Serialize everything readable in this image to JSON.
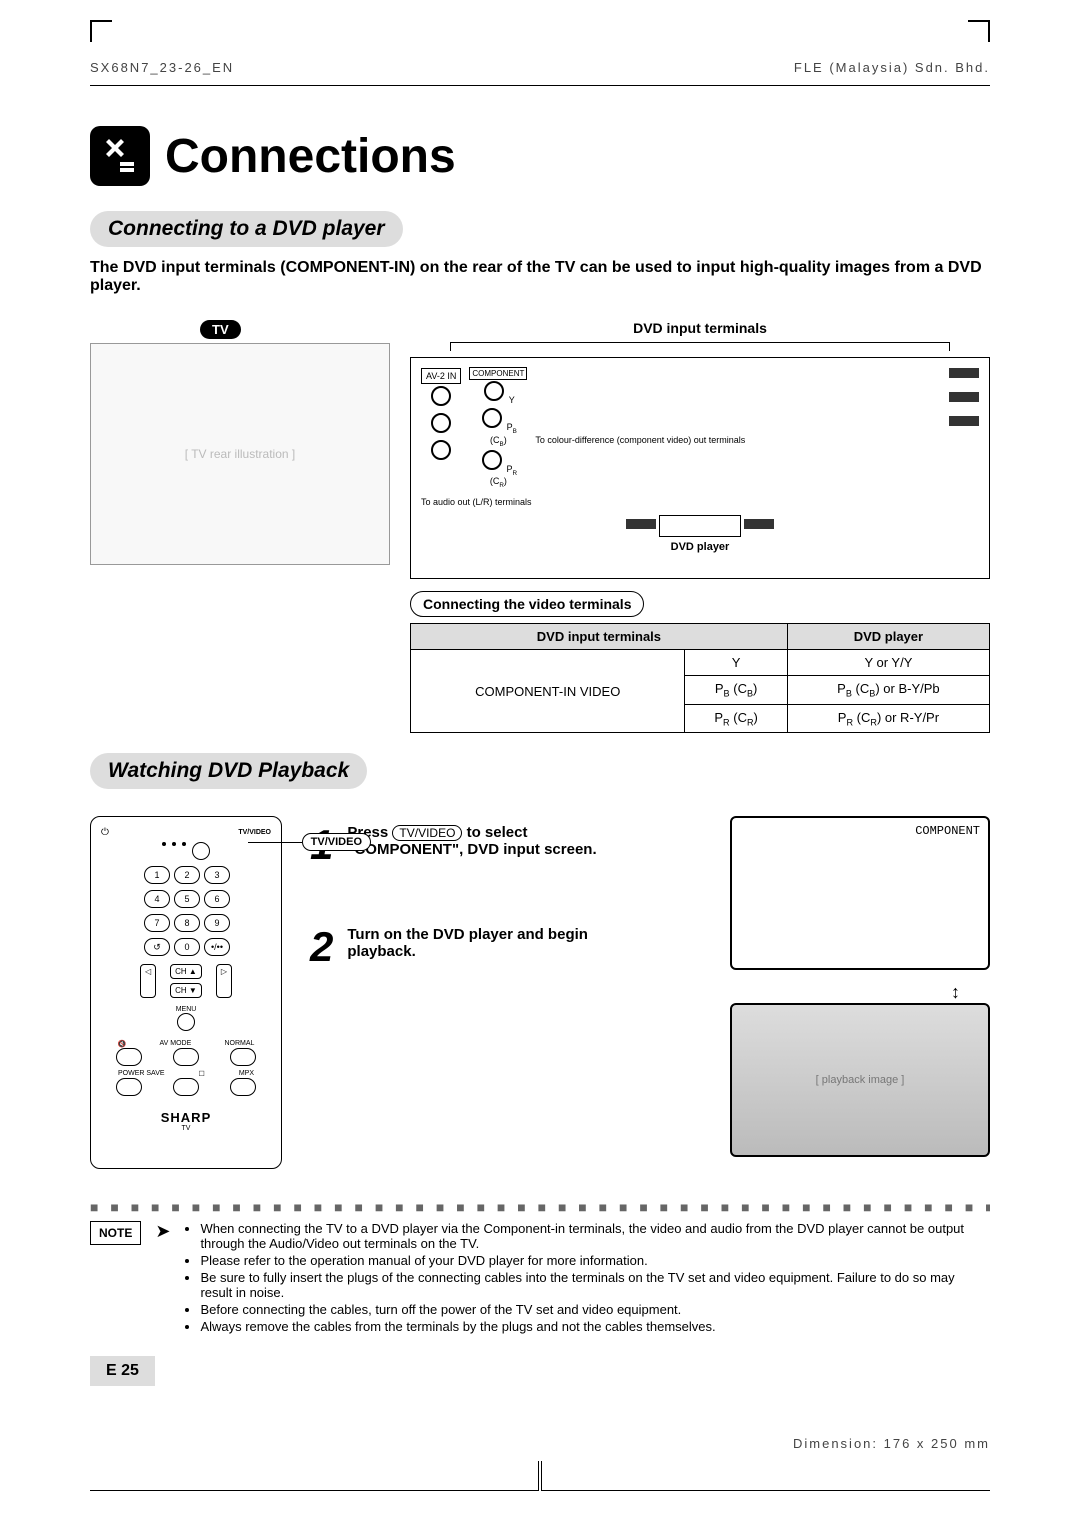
{
  "header": {
    "left": "SX68N7_23-26_EN",
    "right": "FLE (Malaysia) Sdn. Bhd."
  },
  "title": "Connections",
  "section1": {
    "heading": "Connecting to a DVD player",
    "intro": "The DVD input terminals (COMPONENT-IN) on the rear of the TV can be used to input high-quality images from a DVD player."
  },
  "diagram": {
    "tv_label": "TV",
    "terminals_title": "DVD input terminals",
    "av2": "AV-2 IN",
    "component": "COMPONENT",
    "y": "Y",
    "pb": "PB (CB)",
    "pr": "PR (CR)",
    "audio_note": "To audio out (L/R) terminals",
    "video_note": "To colour-difference (component video) out terminals",
    "dvd_label": "DVD player"
  },
  "table": {
    "caption": "Connecting the video terminals",
    "head_left": "DVD input terminals",
    "head_right": "DVD player",
    "rowspan_label": "COMPONENT-IN VIDEO",
    "rows": [
      {
        "in": "Y",
        "out": "Y or Y/Y"
      },
      {
        "in": "PB (CB)",
        "out": "PB (CB) or B-Y/Pb"
      },
      {
        "in": "PR (CR)",
        "out": "PR (CR) or R-Y/Pr"
      }
    ]
  },
  "section2": {
    "heading": "Watching DVD Playback"
  },
  "remote": {
    "tvvideo": "TV/VIDEO",
    "keys": [
      "1",
      "2",
      "3",
      "4",
      "5",
      "6",
      "7",
      "8",
      "9",
      "",
      "0",
      ""
    ],
    "ch_up": "CH ▲",
    "ch_dn": "CH ▼",
    "menu": "MENU",
    "avmode": "AV MODE",
    "normal": "NORMAL",
    "power_save": "POWER SAVE",
    "mpx": "MPX",
    "brand": "SHARP",
    "brand_sub": "TV",
    "callout": "TV/VIDEO"
  },
  "steps": {
    "s1": {
      "num": "1",
      "pre": "Press ",
      "btn": "TV/VIDEO",
      "post": " to select \"COMPONENT\", DVD input screen."
    },
    "s2": {
      "num": "2",
      "text": "Turn on the DVD player and begin playback."
    }
  },
  "screen_tag": "COMPONENT",
  "note_label": "NOTE",
  "notes": [
    "When connecting the TV to a DVD player via the Component-in terminals, the video and audio from the DVD player cannot be output through the Audio/Video out terminals on the TV.",
    "Please refer to the operation manual of your DVD player for more information.",
    "Be sure to fully insert the plugs of the connecting cables into the terminals on the TV set and video equipment. Failure to do so may result in noise.",
    "Before connecting the cables, turn off the power of the TV set and video equipment.",
    "Always remove the cables from the terminals by the plugs and not the cables themselves."
  ],
  "page_number": "E 25",
  "dimension": "Dimension: 176 x 250 mm"
}
